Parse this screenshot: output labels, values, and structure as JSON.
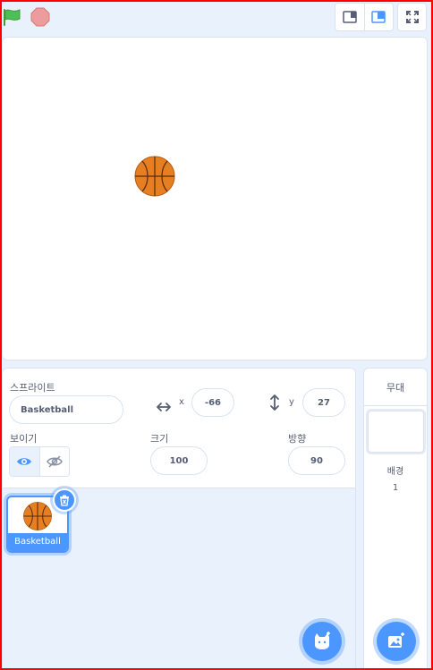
{
  "controls": {
    "green_flag_icon": "green-flag-icon",
    "stop_icon": "stop-icon",
    "small_stage_icon": "small-stage-icon",
    "large_stage_icon": "large-stage-icon",
    "fullscreen_icon": "fullscreen-icon"
  },
  "sprite_info": {
    "sprite_label": "스프라이트",
    "sprite_name": "Basketball",
    "x_label": "x",
    "x_value": "-66",
    "y_label": "y",
    "y_value": "27",
    "show_label": "보이기",
    "size_label": "크기",
    "size_value": "100",
    "direction_label": "방향",
    "direction_value": "90"
  },
  "sprite_list": [
    {
      "name": "Basketball",
      "selected": true
    }
  ],
  "stage_panel": {
    "title": "무대",
    "backdrops_label": "배경",
    "backdrops_count": "1"
  },
  "colors": {
    "accent": "#4c97ff",
    "ball": "#e67e22",
    "flag": "#4cbf56",
    "stop": "#ec9c9c"
  }
}
